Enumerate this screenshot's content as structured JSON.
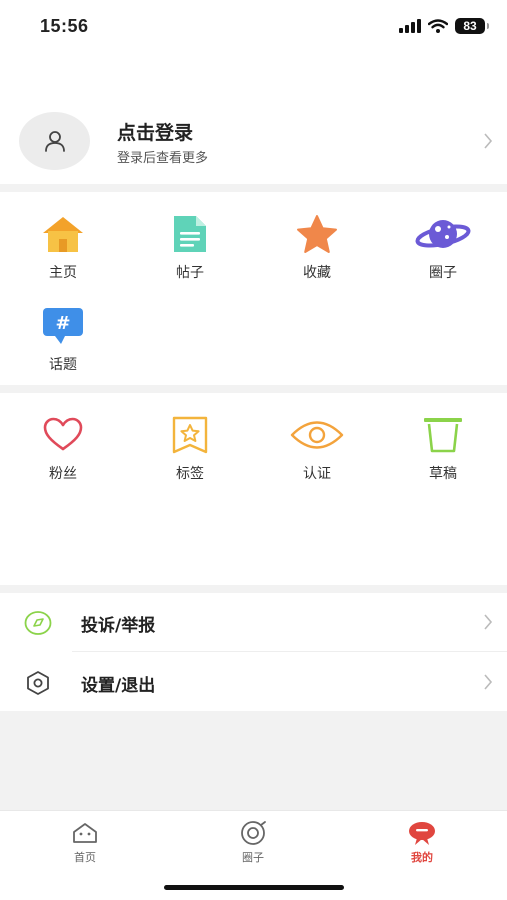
{
  "status_bar": {
    "time": "15:56",
    "battery": "83"
  },
  "profile": {
    "title": "点击登录",
    "subtitle": "登录后查看更多"
  },
  "grid_a": [
    {
      "label": "主页",
      "icon": "home-icon"
    },
    {
      "label": "帖子",
      "icon": "document-icon"
    },
    {
      "label": "收藏",
      "icon": "star-icon"
    },
    {
      "label": "圈子",
      "icon": "planet-icon"
    },
    {
      "label": "话题",
      "icon": "hashtag-icon"
    }
  ],
  "grid_b": [
    {
      "label": "粉丝",
      "icon": "heart-icon"
    },
    {
      "label": "标签",
      "icon": "tag-icon"
    },
    {
      "label": "认证",
      "icon": "eye-icon"
    },
    {
      "label": "草稿",
      "icon": "bin-icon"
    }
  ],
  "menu": [
    {
      "label": "投诉/举报",
      "icon": "report-icon"
    },
    {
      "label": "设置/退出",
      "icon": "settings-icon"
    }
  ],
  "tabs": [
    {
      "label": "首页",
      "icon": "home-tab-icon"
    },
    {
      "label": "圈子",
      "icon": "circle-tab-icon"
    },
    {
      "label": "我的",
      "icon": "mine-tab-icon",
      "active": true
    }
  ],
  "colors": {
    "accent": "#e0463f",
    "home": "#f3b43c",
    "doc": "#3fbfa6",
    "star": "#f08a4b",
    "planet": "#6b5ad6",
    "topic": "#3f8fe8",
    "heart": "#e04a5a",
    "tag": "#f3b43c",
    "eye": "#f3a33c",
    "bin": "#8bd34a"
  }
}
